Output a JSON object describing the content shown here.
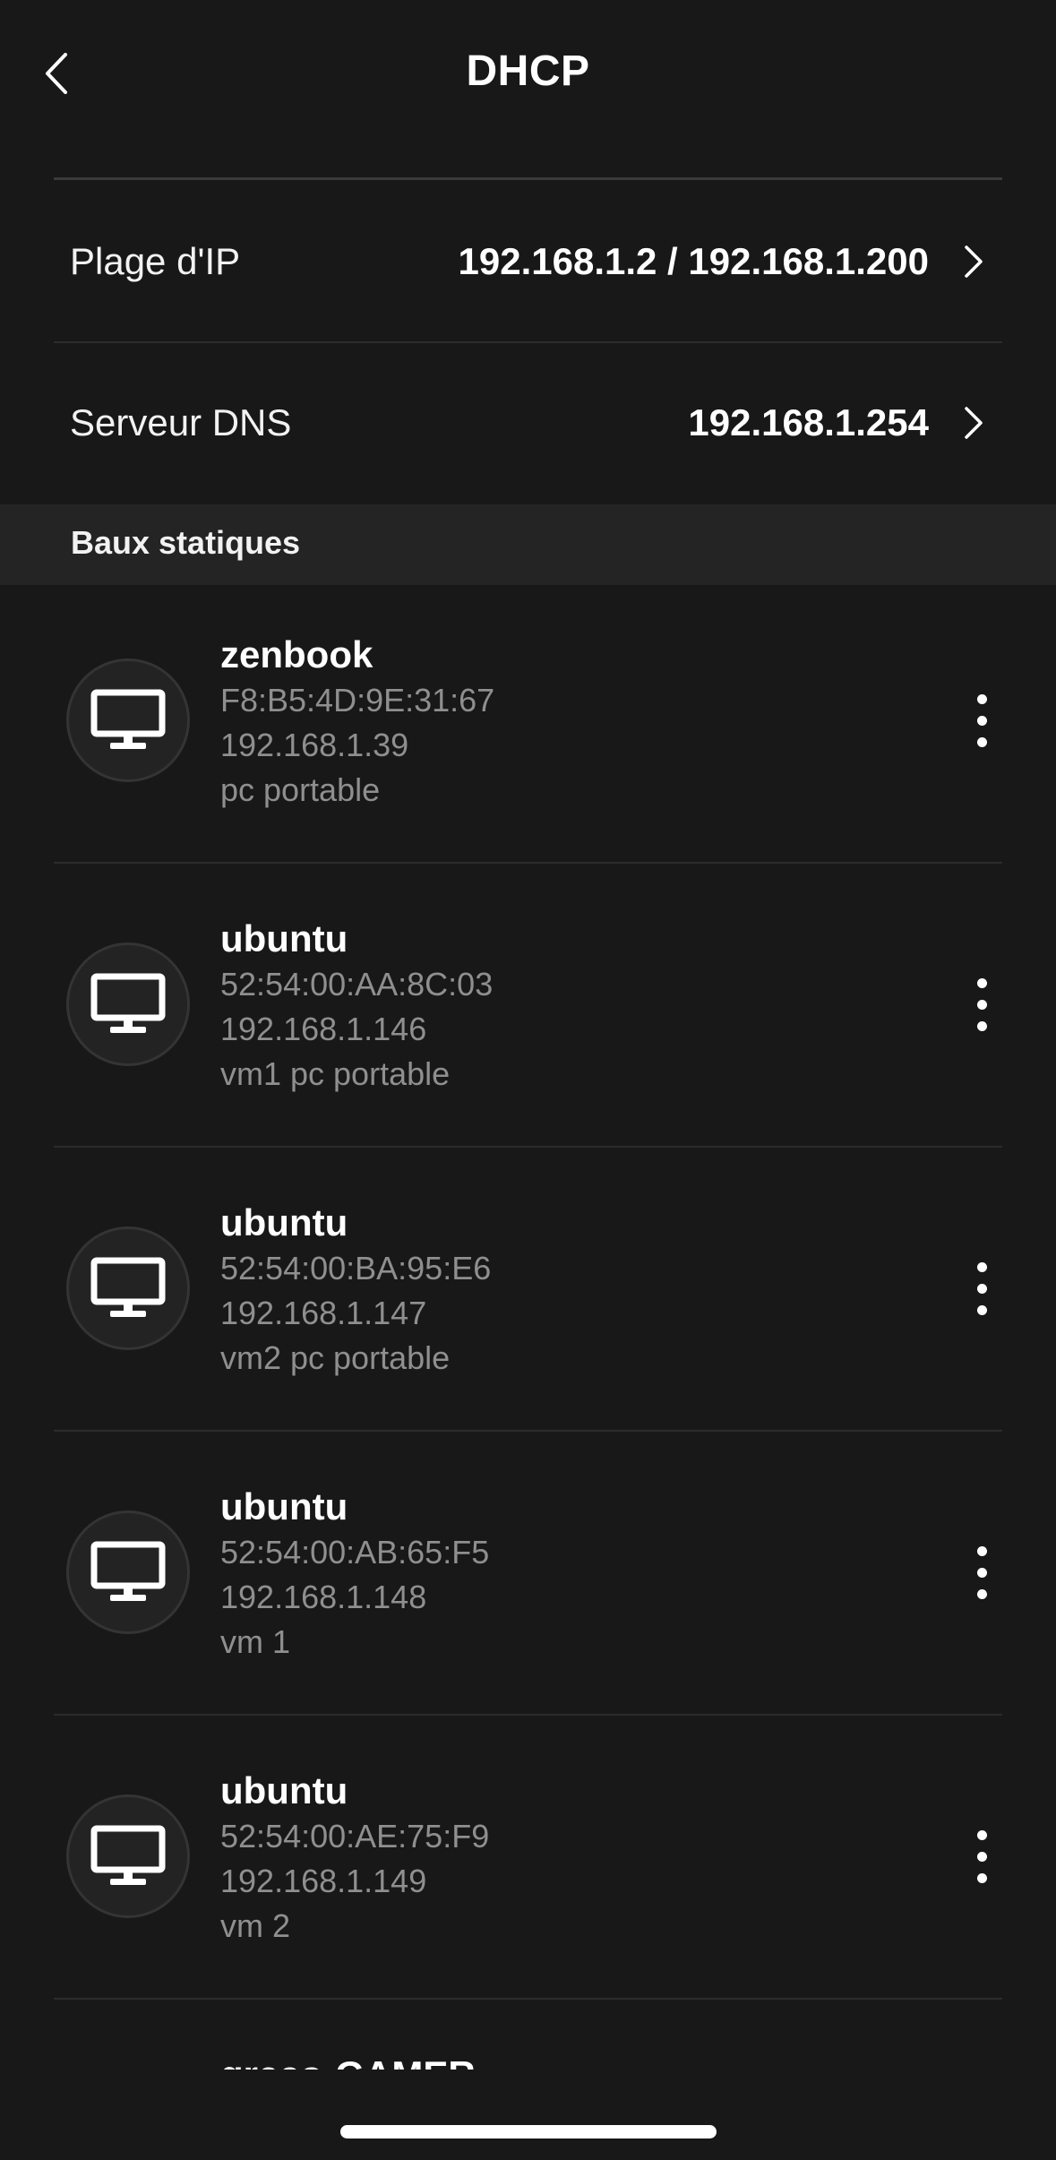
{
  "header": {
    "title": "DHCP"
  },
  "settings": {
    "ip_range": {
      "label": "Plage d'IP",
      "value": "192.168.1.2 / 192.168.1.200"
    },
    "dns_server": {
      "label": "Serveur DNS",
      "value": "192.168.1.254"
    }
  },
  "section": {
    "title": "Baux statiques"
  },
  "leases": [
    {
      "name": "zenbook",
      "mac": "F8:B5:4D:9E:31:67",
      "ip": "192.168.1.39",
      "comment": "pc portable",
      "icon": "monitor-icon"
    },
    {
      "name": "ubuntu",
      "mac": "52:54:00:AA:8C:03",
      "ip": "192.168.1.146",
      "comment": "vm1 pc portable",
      "icon": "monitor-icon"
    },
    {
      "name": "ubuntu",
      "mac": "52:54:00:BA:95:E6",
      "ip": "192.168.1.147",
      "comment": "vm2 pc portable",
      "icon": "monitor-icon"
    },
    {
      "name": "ubuntu",
      "mac": "52:54:00:AB:65:F5",
      "ip": "192.168.1.148",
      "comment": "vm 1",
      "icon": "monitor-icon"
    },
    {
      "name": "ubuntu",
      "mac": "52:54:00:AE:75:F9",
      "ip": "192.168.1.149",
      "comment": "vm 2",
      "icon": "monitor-icon"
    }
  ],
  "partial_lease": {
    "name": "greco-GAMER"
  },
  "colors": {
    "background": "#181818",
    "section_bg": "#242424",
    "secondary_text": "#8f8f8f"
  }
}
